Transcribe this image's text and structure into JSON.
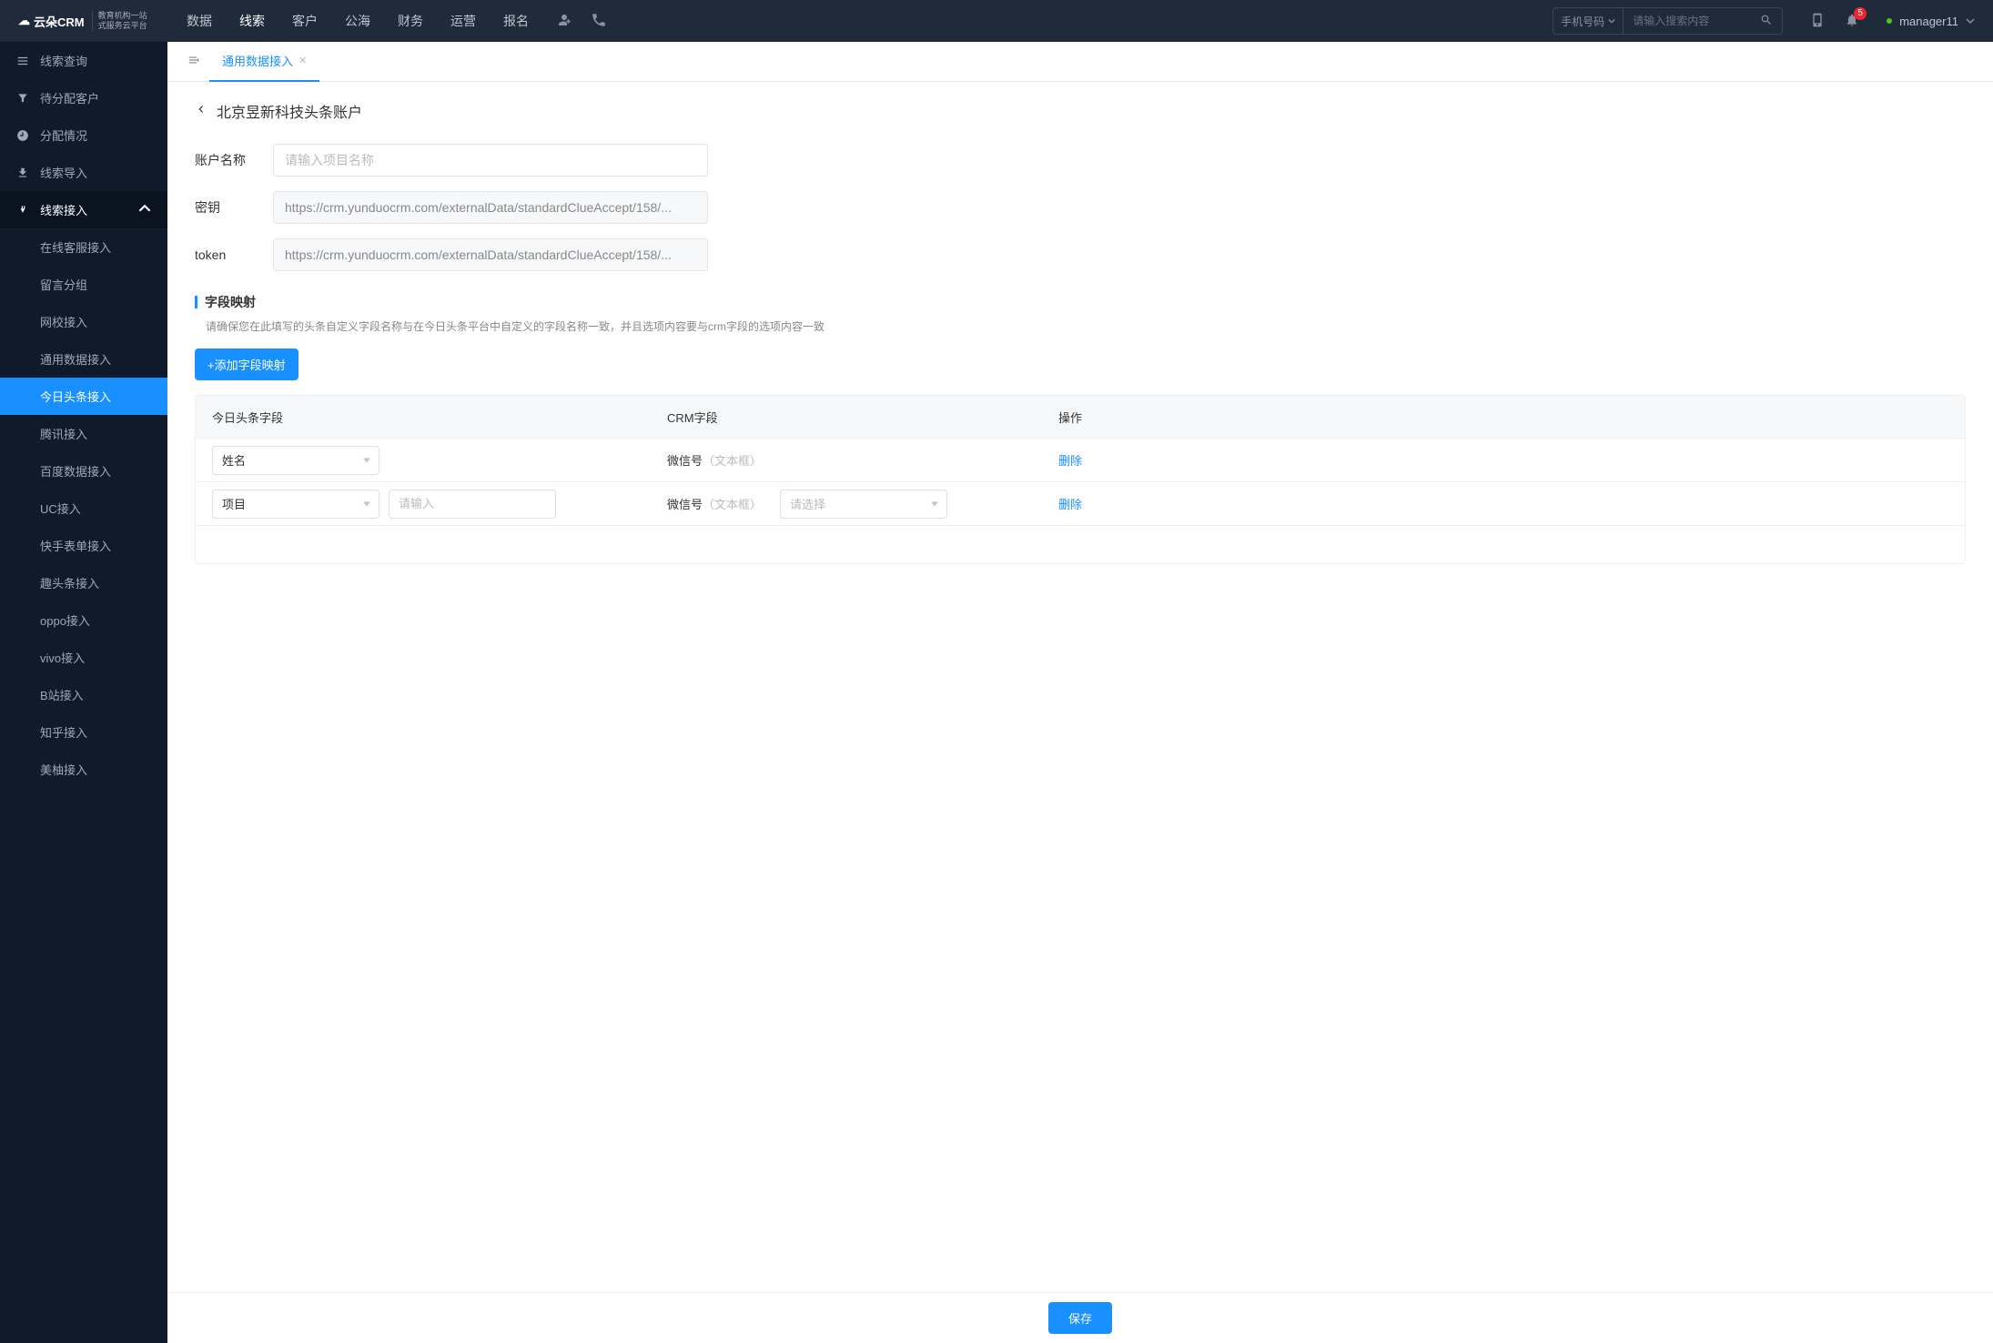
{
  "logo": {
    "name": "云朵CRM",
    "sub1": "教育机构一站",
    "sub2": "式服务云平台"
  },
  "topnav": [
    "数据",
    "线索",
    "客户",
    "公海",
    "财务",
    "运营",
    "报名"
  ],
  "topnav_active": 1,
  "search": {
    "prefix": "手机号码",
    "placeholder": "请输入搜索内容"
  },
  "notifications": {
    "count": "5"
  },
  "user": {
    "name": "manager11"
  },
  "sidebar": {
    "main": [
      {
        "label": "线索查询",
        "icon": "list"
      },
      {
        "label": "待分配客户",
        "icon": "filter"
      },
      {
        "label": "分配情况",
        "icon": "clock"
      },
      {
        "label": "线索导入",
        "icon": "export"
      },
      {
        "label": "线索接入",
        "icon": "plug",
        "expanded": true
      }
    ],
    "sub": [
      "在线客服接入",
      "留言分组",
      "网校接入",
      "通用数据接入",
      "今日头条接入",
      "腾讯接入",
      "百度数据接入",
      "UC接入",
      "快手表单接入",
      "趣头条接入",
      "oppo接入",
      "vivo接入",
      "B站接入",
      "知乎接入",
      "美柚接入"
    ],
    "sub_active": 4
  },
  "tabs": {
    "t1": "通用数据接入"
  },
  "breadcrumb": {
    "title": "北京昱新科技头条账户"
  },
  "form": {
    "account_label": "账户名称",
    "account_placeholder": "请输入项目名称",
    "secret_label": "密钥",
    "secret_value": "https://crm.yunduocrm.com/externalData/standardClueAccept/158/...",
    "token_label": "token",
    "token_value": "https://crm.yunduocrm.com/externalData/standardClueAccept/158/..."
  },
  "mapping": {
    "title": "字段映射",
    "desc": "请确保您在此填写的头条自定义字段名称与在今日头条平台中自定义的字段名称一致，并且选项内容要与crm字段的选项内容一致",
    "add_btn": "+添加字段映射",
    "headers": {
      "c1": "今日头条字段",
      "c2": "CRM字段",
      "c3": "操作"
    },
    "rows": [
      {
        "field": "姓名",
        "crm": "微信号",
        "crm_type": "（文本框）",
        "delete": "删除"
      },
      {
        "field": "项目",
        "input_ph": "请输入",
        "crm": "微信号",
        "crm_type": "（文本框）",
        "sel_ph": "请选择",
        "delete": "删除"
      }
    ]
  },
  "footer": {
    "save": "保存"
  }
}
